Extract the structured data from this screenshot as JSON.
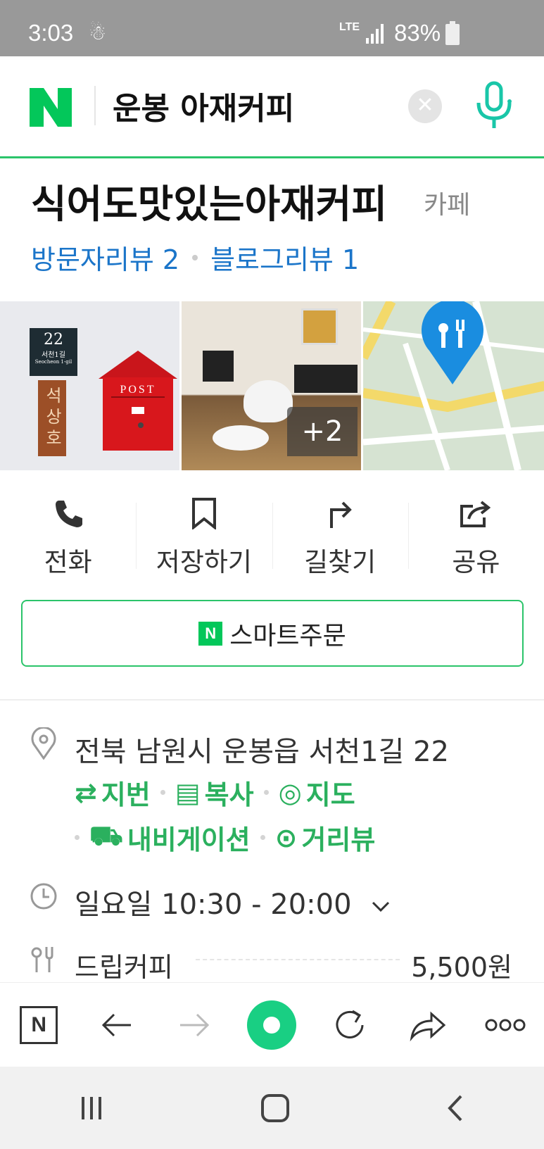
{
  "status_bar": {
    "time": "3:03",
    "network": "LTE",
    "battery": "83%"
  },
  "search": {
    "query": "운봉 아재커피",
    "brand": "N"
  },
  "place": {
    "name": "식어도맛있는아재커피",
    "category": "카페",
    "reviews": {
      "visitor": "방문자리뷰 2",
      "blog": "블로그리뷰 1"
    }
  },
  "photos": {
    "more_count": "+2",
    "sign_number": "22",
    "sign_street": "서천1길",
    "sign_roman": "Seocheon 1-gil",
    "wood_plate": "석상호",
    "mailbox": "POST"
  },
  "actions": [
    {
      "icon": "phone-icon",
      "label": "전화"
    },
    {
      "icon": "bookmark-icon",
      "label": "저장하기"
    },
    {
      "icon": "directions-icon",
      "label": "길찾기"
    },
    {
      "icon": "share-icon",
      "label": "공유"
    }
  ],
  "smart_order": {
    "label": "스마트주문",
    "badge": "N"
  },
  "info": {
    "address": "전북 남원시 운봉읍 서천1길 22",
    "address_links": [
      "지번",
      "복사",
      "지도"
    ],
    "address_links2": [
      "내비게이션",
      "거리뷰"
    ],
    "hours": "일요일 10:30 - 20:00",
    "menu_item": {
      "name": "드립커피",
      "price": "5,500원"
    }
  },
  "bottom_bar": {
    "home_label": "N"
  },
  "colors": {
    "naver_green": "#03c75a",
    "link_blue": "#1b75c9",
    "accent_green": "#2bb05e"
  }
}
